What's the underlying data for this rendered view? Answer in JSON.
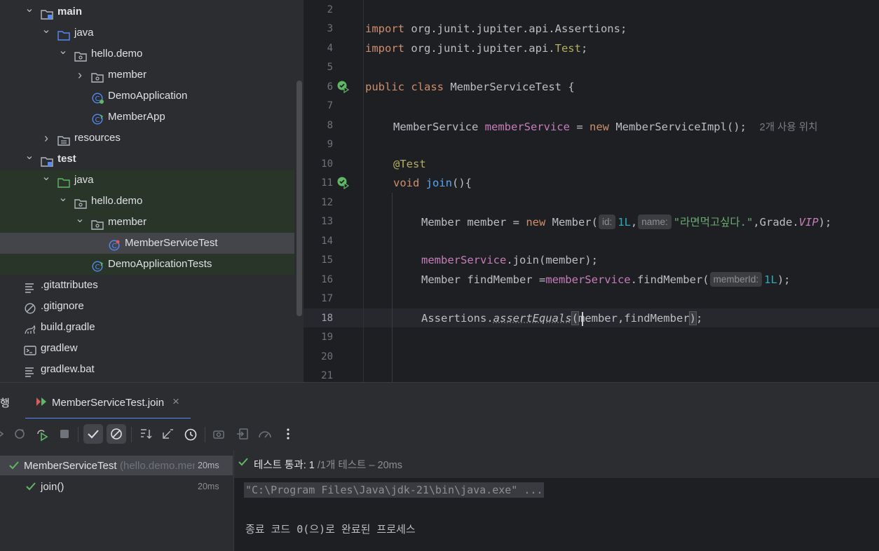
{
  "project_tree": {
    "items": [
      {
        "label": "main",
        "bold": true,
        "arrow": "open",
        "icon": "module-folder-icon"
      },
      {
        "label": "java",
        "arrow": "open",
        "icon": "source-folder-icon"
      },
      {
        "label": "hello.demo",
        "arrow": "open",
        "icon": "package-icon"
      },
      {
        "label": "member",
        "arrow": "closed",
        "icon": "package-icon"
      },
      {
        "label": "DemoApplication",
        "icon": "spring-boot-class-icon"
      },
      {
        "label": "MemberApp",
        "icon": "spring-class-icon"
      },
      {
        "label": "resources",
        "arrow": "closed",
        "icon": "resources-folder-icon"
      },
      {
        "label": "test",
        "bold": true,
        "arrow": "open",
        "icon": "module-folder-icon"
      },
      {
        "label": "java",
        "arrow": "open",
        "icon": "test-source-folder-icon"
      },
      {
        "label": "hello.demo",
        "arrow": "open",
        "icon": "package-icon"
      },
      {
        "label": "member",
        "arrow": "open",
        "icon": "package-icon"
      },
      {
        "label": "MemberServiceTest",
        "icon": "test-class-icon"
      },
      {
        "label": "DemoApplicationTests",
        "icon": "spring-test-class-icon"
      },
      {
        "label": ".gitattributes",
        "icon": "text-file-icon"
      },
      {
        "label": ".gitignore",
        "icon": "ignore-file-icon"
      },
      {
        "label": "build.gradle",
        "icon": "gradle-icon"
      },
      {
        "label": "gradlew",
        "icon": "shell-script-icon"
      },
      {
        "label": "gradlew.bat",
        "icon": "text-file-icon"
      }
    ]
  },
  "editor": {
    "line_numbers": [
      "2",
      "3",
      "4",
      "5",
      "6",
      "7",
      "8",
      "9",
      "10",
      "11",
      "12",
      "13",
      "14",
      "15",
      "16",
      "17",
      "18",
      "19",
      "20",
      "21"
    ],
    "current_line": "18",
    "code": {
      "l3_kw": "import",
      "l3_rest": " org.junit.jupiter.api.Assertions;",
      "l4_kw": "import",
      "l4_rest": " org.junit.jupiter.api.",
      "l4_ann": "Test",
      "l4_semi": ";",
      "l6_kw1": "public",
      "l6_kw2": "class",
      "l6_rest": " MemberServiceTest {",
      "l8_type": "MemberService ",
      "l8_field": "memberService",
      "l8_eq": " = ",
      "l8_new": "new",
      "l8_rest": " MemberServiceImpl();",
      "l8_inlay": "2개 사용 위치",
      "l10_ann": "@Test",
      "l11_kw": "void",
      "l11_fn": "join",
      "l11_rest": "(){",
      "l13_a": "Member member = ",
      "l13_new": "new",
      "l13_b": " Member(",
      "l13_hint1": "id:",
      "l13_num": "1L",
      "l13_comma": ",",
      "l13_hint2": "name:",
      "l13_str": "\"라면먹고싶다.\"",
      "l13_c": ",Grade.",
      "l13_enum": "VIP",
      "l13_d": ");",
      "l15_field": "memberService",
      "l15_rest": ".join(member);",
      "l16_a": "Member findMember =",
      "l16_field": "memberService",
      "l16_b": ".findMember(",
      "l16_hint": "memberId:",
      "l16_num": "1L",
      "l16_c": ");",
      "l18_a": "Assertions.",
      "l18_static": "assertEquals",
      "l18_paren": "(",
      "l18_b": "member,findMember",
      "l18_close": ")",
      "l18_semi": ";"
    }
  },
  "run_window": {
    "title_partial": "행",
    "tab_label": "MemberServiceTest.join",
    "status_text": "테스트 통과:",
    "status_count": "1",
    "status_total": "/1개 테스트 – 20ms",
    "tree": [
      {
        "label": "MemberServiceTest",
        "sub": "(hello.demo.mem",
        "time": "20ms"
      },
      {
        "label": "join()",
        "time": "20ms"
      }
    ],
    "console_cmd": "\"C:\\Program Files\\Java\\jdk-21\\bin\\java.exe\" ...",
    "console_exit": "종료 코드 0(으)로 완료된 프로세스"
  },
  "colors": {
    "accent_green": "#5fb865",
    "accent_blue": "#548af7",
    "background": "#1e1f22",
    "panel": "#2b2d30"
  }
}
